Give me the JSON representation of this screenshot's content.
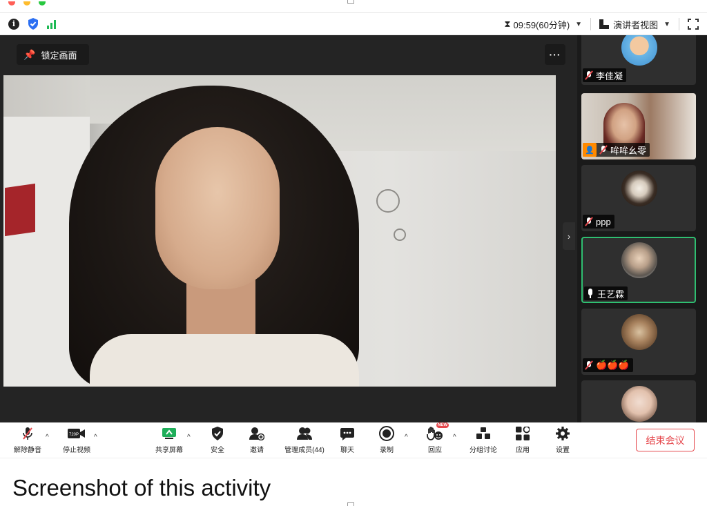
{
  "status_bar": {
    "timer": "09:59(60分钟)",
    "view_label": "演讲者视图"
  },
  "stage": {
    "lock_label": "锁定画面",
    "more_label": "···"
  },
  "participants": [
    {
      "name": "李佳凝",
      "muted": true
    },
    {
      "name": "哞哞幺零",
      "muted": true,
      "host": true
    },
    {
      "name": "ppp",
      "muted": true
    },
    {
      "name": "王艺霖",
      "muted": false,
      "active": true
    },
    {
      "name": "🍎🍎🍎",
      "muted": true
    },
    {
      "name": "",
      "muted": true
    }
  ],
  "toolbar": {
    "mute_label": "解除静音",
    "video_label": "停止视频",
    "video_badge": "720P",
    "share_label": "共享屏幕",
    "security_label": "安全",
    "invite_label": "邀请",
    "members_label": "管理成员(44)",
    "chat_label": "聊天",
    "record_label": "录制",
    "reaction_label": "回应",
    "reaction_badge": "NEW",
    "breakout_label": "分组讨论",
    "apps_label": "应用",
    "settings_label": "设置",
    "end_label": "结束会议"
  },
  "caption": "Screenshot of this activity",
  "colors": {
    "accent_green": "#2fbf71",
    "end_red": "#e5484d",
    "host_orange": "#ff8a00"
  }
}
